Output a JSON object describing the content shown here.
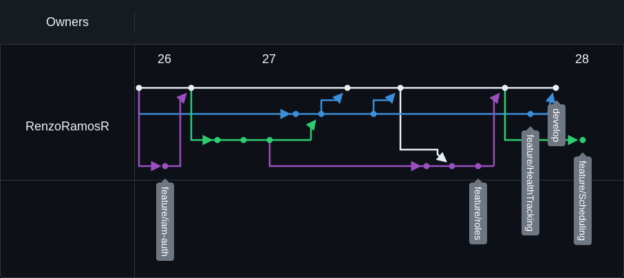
{
  "header": {
    "owners_label": "Owners"
  },
  "owner": {
    "name": "RenzoRamosR"
  },
  "dates": [
    "26",
    "27",
    "28"
  ],
  "branches": {
    "main_color": "#e6edf3",
    "develop": {
      "label": "develop",
      "color": "#3b8fd9"
    },
    "feature_scheduling": {
      "label": "feature/Scheduling",
      "color": "#2ecc71"
    },
    "feature_roles": {
      "label": "feature/roles",
      "color": "#9b4fc0"
    },
    "feature_iam_auth": {
      "label": "feature/iam-auth",
      "color": "#9b4fc0"
    },
    "feature_health_tracking": {
      "label": "feature/HealthTracking",
      "color": "#3b8fd9"
    }
  }
}
